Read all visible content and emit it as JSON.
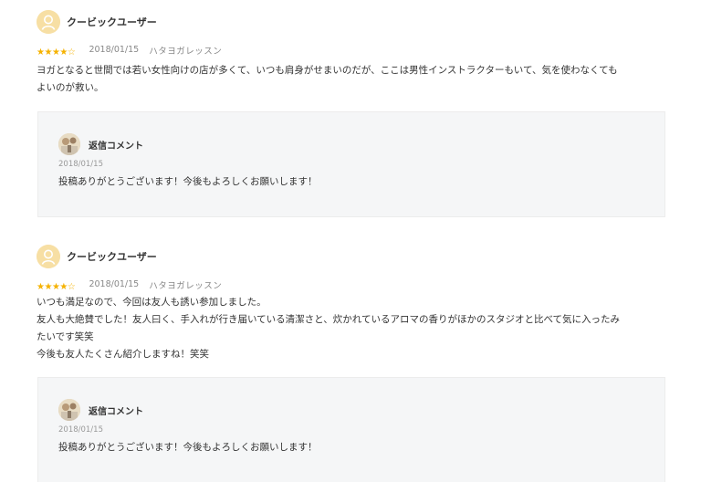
{
  "reviews": [
    {
      "user": "クービックユーザー",
      "avatar_icon": "user-icon",
      "rating": 4,
      "rating_max": 5,
      "stars": [
        "★",
        "★",
        "★",
        "★",
        "☆"
      ],
      "date": "2018/01/15",
      "studio": "ハタヨガレッスン",
      "body": [
        "ヨガとなると世間では若い女性向けの店が多くて、いつも肩身がせまいのだが、ここは男性インストラクターもいて、気を使わなくても",
        "よいのが救い。"
      ],
      "reply": {
        "title": "返信コメント",
        "date": "2018/01/15",
        "text": "投稿ありがとうございます！今後もよろしくお願いします！"
      }
    },
    {
      "user": "クービックユーザー",
      "avatar_icon": "user-icon",
      "rating": 4,
      "rating_max": 5,
      "stars": [
        "★",
        "★",
        "★",
        "★",
        "☆"
      ],
      "date": "2018/01/15",
      "studio": "ハタヨガレッスン",
      "body": [
        "いつも満足なので、今回は友人も誘い参加しました。",
        "友人も大絶賛でした！友人曰く、手入れが行き届いている清潔さと、炊かれているアロマの香りがほかのスタジオと比べて気に入ったみ",
        "たいです笑笑",
        "今後も友人たくさん紹介しますね！笑笑"
      ],
      "reply": {
        "title": "返信コメント",
        "date": "2018/01/15",
        "text": "投稿ありがとうございます！今後もよろしくお願いします！"
      }
    }
  ],
  "colors": {
    "star": "#f5b200",
    "avatar_bg": "#f7dfa4",
    "reply_bg": "#f5f6f7"
  }
}
